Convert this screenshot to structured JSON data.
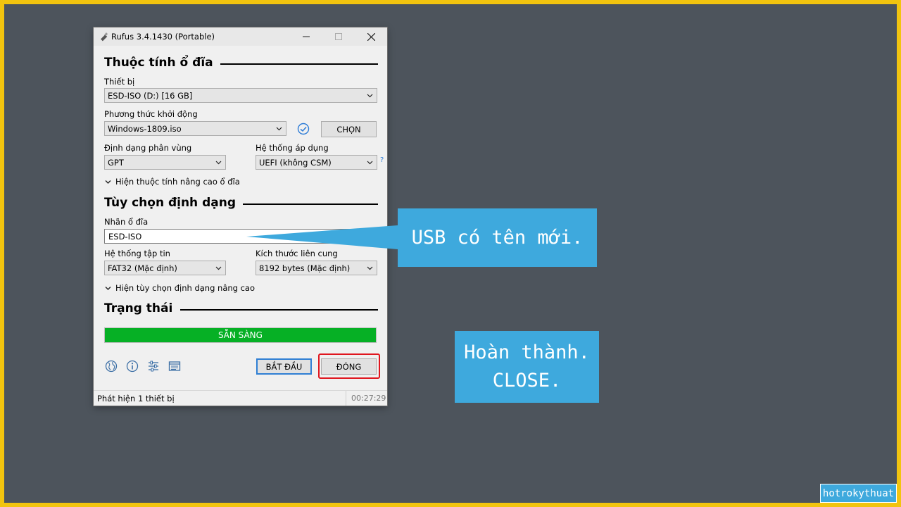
{
  "window": {
    "title": "Rufus 3.4.1430 (Portable)",
    "controls": [
      "minimize",
      "maximize",
      "close"
    ]
  },
  "drive_properties": {
    "heading": "Thuộc tính ổ đĩa",
    "device_label": "Thiết bị",
    "device_value": "ESD-ISO (D:) [16 GB]",
    "boot_selection_label": "Phương thức khởi động",
    "boot_selection_value": "Windows-1809.iso",
    "select_button": "CHỌN",
    "partition_scheme_label": "Định dạng phân vùng",
    "partition_scheme_value": "GPT",
    "target_system_label": "Hệ thống áp dụng",
    "target_system_value": "UEFI (không CSM)",
    "help_mark": "?",
    "advanced_toggle": "Hiện thuộc tính nâng cao ổ đĩa"
  },
  "format_options": {
    "heading": "Tùy chọn định dạng",
    "volume_label_label": "Nhãn ổ đĩa",
    "volume_label_value": "ESD-ISO",
    "file_system_label": "Hệ thống tập tin",
    "file_system_value": "FAT32 (Mặc định)",
    "cluster_size_label": "Kích thước liên cung",
    "cluster_size_value": "8192 bytes (Mặc định)",
    "advanced_toggle": "Hiện tùy chọn định dạng nâng cao"
  },
  "status": {
    "heading": "Trạng thái",
    "progress_text": "SẴN SÀNG",
    "progress_fraction": 1.0,
    "progress_color": "#06b025"
  },
  "toolbar": {
    "icons": [
      "globe-icon",
      "info-icon",
      "settings-icon",
      "log-icon"
    ],
    "start_button": "BẮT ĐẦU",
    "close_button": "ĐÓNG"
  },
  "statusbar": {
    "text": "Phát hiện 1 thiết bị",
    "time": "00:27:29"
  },
  "callouts": {
    "usb_new_name": "USB có tên mới.",
    "done_line1": "Hoàn thành.",
    "done_line2": "CLOSE."
  },
  "watermark": "hotrokythuat",
  "colors": {
    "frame": "#f2c40f",
    "background": "#4d545c",
    "callout": "#3ea9dd",
    "highlight": "#e0161e"
  }
}
